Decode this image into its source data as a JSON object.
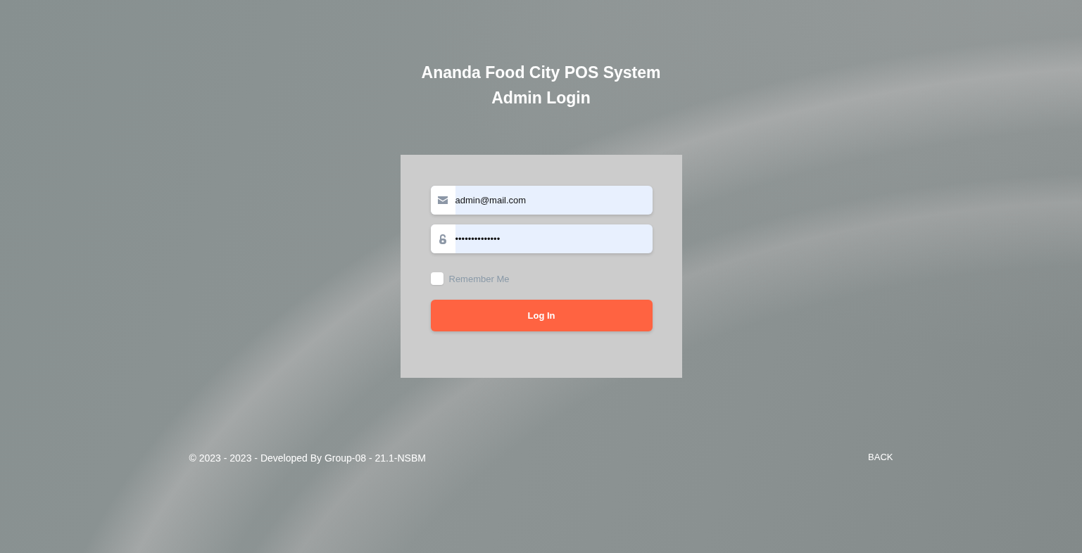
{
  "header": {
    "title": "Ananda Food City POS System",
    "subtitle": "Admin Login"
  },
  "form": {
    "fields": [
      {
        "kind": "email",
        "value": "admin@mail.com"
      },
      {
        "kind": "password",
        "value": "••••••••••••••"
      }
    ],
    "remember_me": {
      "label": "Remember Me",
      "checked": false
    },
    "submit_button": "Log In"
  },
  "footer": {
    "copyright": "© 2023 - 2023 - Developed By Group-08 - 21.1-NSBM",
    "back_link": "BACK"
  }
}
